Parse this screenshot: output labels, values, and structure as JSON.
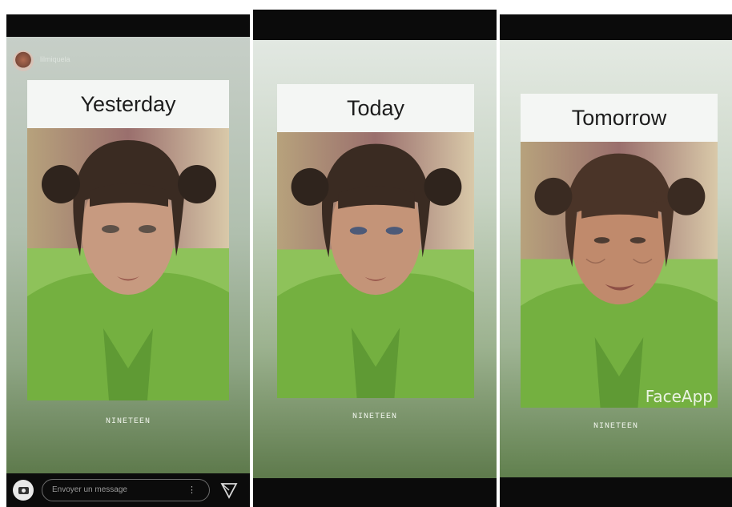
{
  "app": "Instagram Stories",
  "panels": [
    {
      "title": "Yesterday",
      "caption": "NINETEEN",
      "header": {
        "username": "lilmiquela",
        "time": ""
      },
      "status_time": "",
      "reply": {
        "placeholder": "Envoyer un message"
      }
    },
    {
      "title": "Today",
      "caption": "NINETEEN",
      "status_time": ""
    },
    {
      "title": "Tomorrow",
      "caption": "NINETEEN",
      "watermark": "FaceApp",
      "status_time": ""
    }
  ],
  "colors": {
    "story_bg_top": "#dfe6e0",
    "story_bg_bottom": "#5e7a4c",
    "shirt_green": "#74b040",
    "hair": "#3a2b22",
    "status_bar": "#0b0b0b"
  },
  "icons": [
    "camera-icon",
    "send-icon",
    "more-icon"
  ]
}
